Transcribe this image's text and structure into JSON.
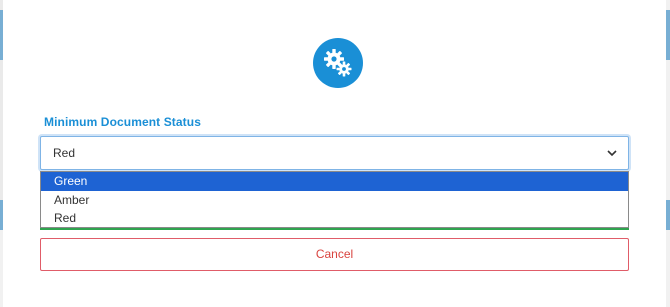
{
  "dialog": {
    "icon": "gears-icon",
    "field_label": "Minimum Document Status",
    "select": {
      "value": "Red",
      "options": [
        "Green",
        "Amber",
        "Red"
      ],
      "highlighted_option": "Green"
    },
    "cancel_label": "Cancel"
  },
  "colors": {
    "accent": "#1a8fd6",
    "highlight": "#1e63d3",
    "cancel": "#d9443f",
    "success_line": "#2fa44f"
  }
}
